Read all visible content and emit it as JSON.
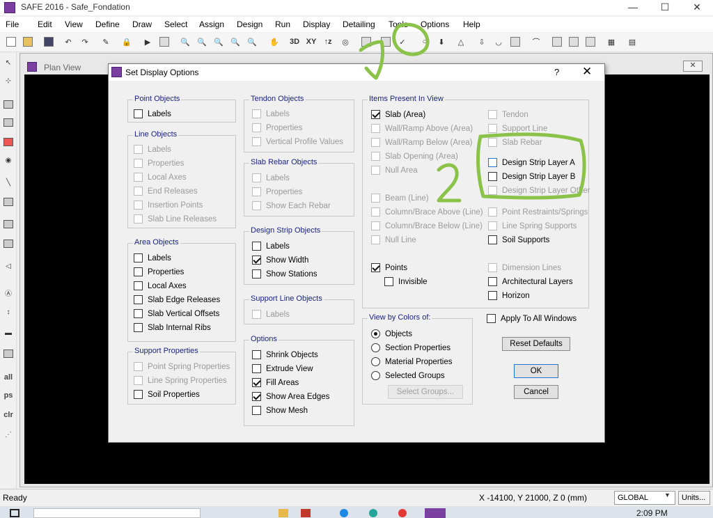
{
  "window": {
    "title": "SAFE 2016 - Safe_Fondation",
    "min": "—",
    "max": "☐",
    "close": "✕"
  },
  "menu": [
    "File",
    "Edit",
    "View",
    "Define",
    "Draw",
    "Select",
    "Assign",
    "Design",
    "Run",
    "Display",
    "Detailing",
    "Tools",
    "Options",
    "Help"
  ],
  "toolbar": {
    "btn_3d": "3D",
    "btn_xy": "XY",
    "btn_xz": "↑z"
  },
  "lefttool": {
    "all": "all",
    "ps": "ps",
    "clr": "clr"
  },
  "planview": {
    "title": "Plan View",
    "close": "✕"
  },
  "dialog": {
    "title": "Set Display Options",
    "help": "?",
    "close": "✕",
    "point_objects": {
      "title": "Point Objects",
      "labels": "Labels"
    },
    "line_objects": {
      "title": "Line Objects",
      "items": [
        "Labels",
        "Properties",
        "Local Axes",
        "End Releases",
        "Insertion Points",
        "Slab Line Releases"
      ]
    },
    "area_objects": {
      "title": "Area Objects",
      "items": [
        "Labels",
        "Properties",
        "Local Axes",
        "Slab Edge Releases",
        "Slab Vertical Offsets",
        "Slab Internal Ribs"
      ]
    },
    "support_properties": {
      "title": "Support Properties",
      "items": [
        "Point Spring Properties",
        "Line Spring Properties",
        "Soil Properties"
      ]
    },
    "tendon_objects": {
      "title": "Tendon Objects",
      "items": [
        "Labels",
        "Properties",
        "Vertical Profile Values"
      ]
    },
    "slab_rebar_objects": {
      "title": "Slab Rebar Objects",
      "items": [
        "Labels",
        "Properties",
        "Show Each Rebar"
      ]
    },
    "design_strip_objects": {
      "title": "Design Strip Objects",
      "items": [
        "Labels",
        "Show Width",
        "Show Stations"
      ]
    },
    "support_line_objects": {
      "title": "Support Line Objects",
      "items": [
        "Labels"
      ]
    },
    "options": {
      "title": "Options",
      "items": [
        "Shrink Objects",
        "Extrude View",
        "Fill Areas",
        "Show Area Edges",
        "Show Mesh"
      ]
    },
    "items_present": {
      "title": "Items Present In View",
      "left": [
        "Slab (Area)",
        "Wall/Ramp Above (Area)",
        "Wall/Ramp Below (Area)",
        "Slab Opening (Area)",
        "Null Area",
        "Beam (Line)",
        "Column/Brace Above (Line)",
        "Column/Brace Below (Line)",
        "Null Line",
        "Points",
        "Invisible"
      ],
      "right": [
        "Tendon",
        "Support Line",
        "Slab Rebar",
        "Design Strip Layer A",
        "Design Strip Layer B",
        "Design Strip Layer Other",
        "Point Restraints/Springs",
        "Line Spring Supports",
        "Soil Supports",
        "Dimension Lines",
        "Architectural Layers",
        "Horizon"
      ]
    },
    "view_by_colors": {
      "title": "View by Colors of:",
      "options": [
        "Objects",
        "Section Properties",
        "Material Properties",
        "Selected Groups"
      ],
      "selected": "Objects",
      "select_groups_button": "Select Groups..."
    },
    "apply_all_windows": "Apply To All Windows",
    "reset_defaults": "Reset Defaults",
    "ok": "OK",
    "cancel": "Cancel"
  },
  "annotations": {
    "mark1": "1",
    "mark2": "2"
  },
  "status": {
    "ready": "Ready",
    "coords": "X -14100,  Y 21000,  Z 0   (mm)",
    "coord_system": "GLOBAL",
    "units": "Units..."
  },
  "taskbar": {
    "clock": "2:09 PM"
  },
  "colors": {
    "accent": "#1e73d2",
    "group_title": "#1a237e",
    "annotation": "#8bc34a",
    "canvas": "#000000"
  }
}
